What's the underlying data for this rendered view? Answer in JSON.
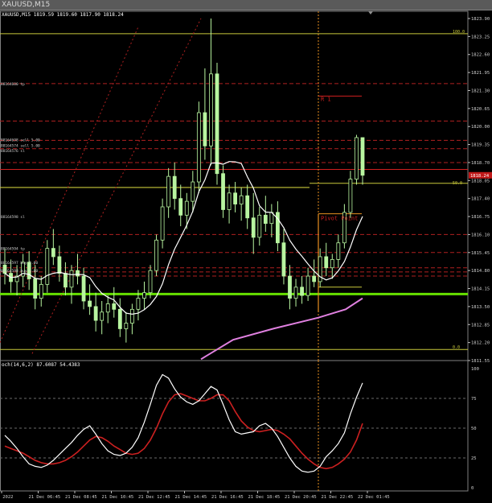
{
  "window": {
    "title": "XAUUSD,M15"
  },
  "header": {
    "info": "XAUUSD,M15  1819.59 1819.60 1817.90 1818.24"
  },
  "colors": {
    "bg": "#000000",
    "grid": "#3a3a3a",
    "candle": "#b8f5a0",
    "ma_fast": "#ffffff",
    "ma_slow": "#e080e0",
    "yellow": "#c8c83a",
    "green_line": "#66e000",
    "red_dash": "#b02020",
    "orange": "#e89020",
    "stoch_main": "#ffffff",
    "stoch_signal": "#cc2020",
    "price_label_bg": "#c01818"
  },
  "price_axis": {
    "ticks": [
      "1823.90",
      "1823.25",
      "1822.60",
      "1821.95",
      "1821.30",
      "1820.65",
      "1820.00",
      "1819.35",
      "1818.70",
      "1818.05",
      "1817.40",
      "1816.75",
      "1816.10",
      "1815.45",
      "1814.80",
      "1814.15",
      "1813.50",
      "1812.85",
      "1812.20",
      "1811.55"
    ],
    "current_price": "1818.24",
    "fib_tags": [
      "100.0",
      "50.0",
      "0.0"
    ]
  },
  "time_axis": {
    "labels": [
      "Dec 2022",
      "21 Dec 06:45",
      "21 Dec 08:45",
      "21 Dec 10:45",
      "21 Dec 12:45",
      "21 Dec 14:45",
      "21 Dec 16:45",
      "21 Dec 18:45",
      "21 Dec 20:45",
      "21 Dec 22:45",
      "22 Dec 01:45"
    ]
  },
  "annotations": {
    "r1": "R 1",
    "pivot": "Pivot Point",
    "order_labels": [
      "88164600 tp",
      "88164698 sell 5.00",
      "88164574 sell 5.00",
      "88164576 sl",
      "88164598 sl",
      "88164594 tp",
      "88164597 buy 5.00",
      "88164598 buy 5.00"
    ]
  },
  "stoch": {
    "title": "och(14,6,2) 87.6087 54.4383",
    "levels": [
      "100",
      "75",
      "50",
      "25",
      "0"
    ]
  },
  "chart_data": {
    "type": "candlestick",
    "symbol": "XAUUSD",
    "timeframe": "M15",
    "ylim": [
      1811.55,
      1823.9
    ],
    "x_labels": [
      "Dec 2022",
      "21 Dec 06:45",
      "21 Dec 08:45",
      "21 Dec 10:45",
      "21 Dec 12:45",
      "21 Dec 14:45",
      "21 Dec 16:45",
      "21 Dec 18:45",
      "21 Dec 20:45",
      "21 Dec 22:45",
      "22 Dec 01:45"
    ],
    "last": {
      "open": 1819.59,
      "high": 1819.6,
      "low": 1817.9,
      "close": 1818.24
    },
    "series": [
      {
        "ohlc": [
          [
            1815.0,
            1815.6,
            1814.3,
            1814.7
          ],
          [
            1814.7,
            1815.2,
            1814.0,
            1814.4
          ],
          [
            1814.4,
            1815.0,
            1813.9,
            1814.6
          ],
          [
            1814.6,
            1815.4,
            1814.2,
            1815.1
          ],
          [
            1815.1,
            1815.5,
            1814.1,
            1814.5
          ],
          [
            1814.5,
            1815.0,
            1813.4,
            1813.8
          ],
          [
            1813.8,
            1814.6,
            1813.5,
            1814.3
          ],
          [
            1814.3,
            1815.9,
            1814.0,
            1815.6
          ],
          [
            1815.6,
            1816.3,
            1815.0,
            1815.3
          ],
          [
            1815.3,
            1815.7,
            1814.4,
            1814.7
          ],
          [
            1814.7,
            1815.1,
            1813.9,
            1814.2
          ],
          [
            1814.2,
            1815.0,
            1813.6,
            1814.8
          ],
          [
            1814.8,
            1815.4,
            1814.3,
            1814.6
          ],
          [
            1814.6,
            1814.9,
            1813.4,
            1813.7
          ],
          [
            1813.7,
            1814.3,
            1813.2,
            1813.5
          ],
          [
            1813.5,
            1814.0,
            1812.6,
            1813.0
          ],
          [
            1813.0,
            1813.7,
            1812.5,
            1813.3
          ],
          [
            1813.3,
            1813.9,
            1812.9,
            1813.6
          ],
          [
            1813.6,
            1814.2,
            1813.1,
            1813.4
          ],
          [
            1813.4,
            1813.8,
            1812.4,
            1812.7
          ],
          [
            1812.7,
            1813.3,
            1812.2,
            1812.9
          ],
          [
            1812.9,
            1813.6,
            1812.5,
            1813.4
          ],
          [
            1813.4,
            1814.1,
            1813.0,
            1813.8
          ],
          [
            1813.8,
            1814.4,
            1813.4,
            1814.0
          ],
          [
            1814.0,
            1815.0,
            1813.8,
            1814.8
          ],
          [
            1814.8,
            1816.1,
            1814.6,
            1815.9
          ],
          [
            1815.9,
            1817.4,
            1815.6,
            1817.1
          ],
          [
            1817.1,
            1818.5,
            1816.7,
            1818.2
          ],
          [
            1818.2,
            1818.7,
            1817.0,
            1817.4
          ],
          [
            1817.4,
            1817.9,
            1816.4,
            1816.8
          ],
          [
            1816.8,
            1817.6,
            1816.3,
            1817.3
          ],
          [
            1817.3,
            1818.4,
            1816.9,
            1818.0
          ],
          [
            1818.0,
            1820.9,
            1817.6,
            1820.5
          ],
          [
            1820.5,
            1822.1,
            1818.8,
            1819.3
          ],
          [
            1819.3,
            1823.9,
            1818.6,
            1821.9
          ],
          [
            1821.9,
            1822.3,
            1817.9,
            1818.3
          ],
          [
            1818.3,
            1818.6,
            1816.7,
            1817.0
          ],
          [
            1817.0,
            1817.9,
            1816.5,
            1817.6
          ],
          [
            1817.6,
            1818.0,
            1816.9,
            1817.2
          ],
          [
            1817.2,
            1817.8,
            1816.6,
            1817.5
          ],
          [
            1817.5,
            1817.9,
            1816.3,
            1816.7
          ],
          [
            1816.7,
            1817.6,
            1815.4,
            1816.0
          ],
          [
            1816.0,
            1817.1,
            1815.7,
            1816.8
          ],
          [
            1816.8,
            1817.5,
            1816.2,
            1816.5
          ],
          [
            1816.5,
            1817.2,
            1816.0,
            1816.9
          ],
          [
            1816.9,
            1817.3,
            1815.5,
            1815.8
          ],
          [
            1815.8,
            1816.3,
            1814.3,
            1814.6
          ],
          [
            1814.6,
            1815.0,
            1813.4,
            1813.8
          ],
          [
            1813.8,
            1814.5,
            1813.5,
            1814.2
          ],
          [
            1814.2,
            1814.6,
            1813.6,
            1813.9
          ],
          [
            1813.9,
            1814.9,
            1813.7,
            1814.6
          ],
          [
            1814.6,
            1815.2,
            1814.2,
            1814.4
          ],
          [
            1814.4,
            1815.6,
            1814.2,
            1815.3
          ],
          [
            1815.3,
            1815.8,
            1814.6,
            1814.9
          ],
          [
            1814.9,
            1815.4,
            1814.5,
            1815.2
          ],
          [
            1815.2,
            1816.1,
            1814.9,
            1815.8
          ],
          [
            1815.8,
            1817.2,
            1815.6,
            1816.9
          ],
          [
            1816.9,
            1818.4,
            1816.7,
            1818.1
          ],
          [
            1818.1,
            1819.7,
            1817.9,
            1819.6
          ],
          [
            1819.6,
            1819.6,
            1817.9,
            1818.24
          ]
        ]
      }
    ],
    "levels": {
      "fib_100": 1823.35,
      "fib_50": 1817.95,
      "fib_0": 1811.75,
      "r1": 1821.1,
      "pivot": 1816.85,
      "green_support": 1813.95,
      "yellow_upper": 1817.8,
      "yellow_lower": 1811.95
    },
    "stochastic": {
      "params": "14,6,2",
      "main_last": 87.6087,
      "signal_last": 54.4383,
      "ylim": [
        0,
        100
      ],
      "main": [
        44,
        39,
        33,
        26,
        20,
        18,
        17,
        19,
        23,
        28,
        33,
        38,
        44,
        49,
        52,
        45,
        37,
        31,
        28,
        27,
        29,
        34,
        42,
        55,
        70,
        86,
        95,
        92,
        83,
        76,
        72,
        70,
        73,
        79,
        85,
        82,
        70,
        57,
        47,
        45,
        46,
        47,
        52,
        54,
        50,
        43,
        34,
        25,
        18,
        14,
        13,
        14,
        18,
        26,
        31,
        37,
        46,
        62,
        76,
        88
      ],
      "signal": [
        35,
        33,
        31,
        29,
        26,
        23,
        21,
        20,
        20,
        21,
        23,
        26,
        30,
        35,
        40,
        43,
        42,
        39,
        35,
        32,
        29,
        28,
        29,
        33,
        40,
        50,
        62,
        72,
        78,
        79,
        77,
        75,
        73,
        73,
        75,
        78,
        78,
        73,
        64,
        56,
        51,
        48,
        47,
        48,
        49,
        48,
        45,
        41,
        35,
        29,
        24,
        20,
        17,
        16,
        17,
        20,
        24,
        30,
        40,
        54
      ]
    }
  }
}
